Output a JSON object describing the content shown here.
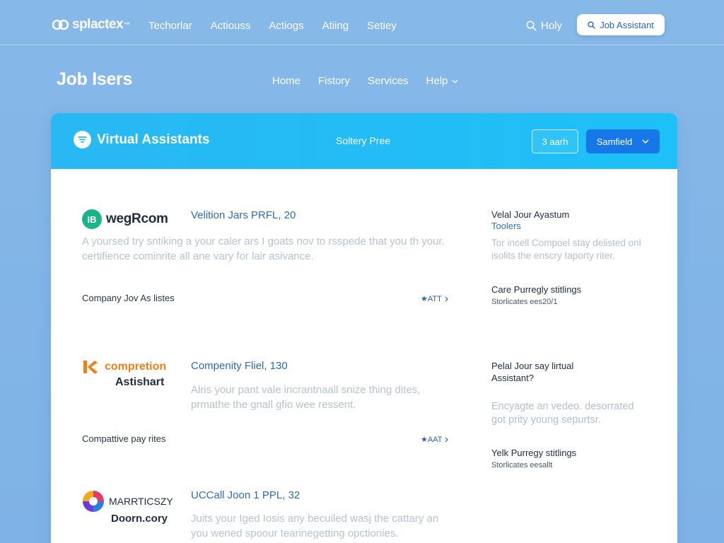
{
  "topbar": {
    "brand": "splactex",
    "brand_tm": "™",
    "nav": [
      "Techorlar",
      "Actiouss",
      "Actiogs",
      "Atiing",
      "Setiey"
    ],
    "search_label": "Holy",
    "job_button": "Job Assistant"
  },
  "subheader": {
    "title": "Job Isers",
    "nav": [
      "Home",
      "Fistory",
      "Services",
      "Help"
    ]
  },
  "panel": {
    "title": "Virtual Assistants",
    "center_text": "Soltery Pree",
    "search_chip": "3 aarh",
    "select_value": "Samfield"
  },
  "listings": [
    {
      "logo_mark": "IB",
      "logo_text": "wegRcom",
      "title": "Velition Jars PRFL, 20",
      "description": "A yoursed try sntiking a your caler ars I goats nov to rsspede that you th your. certifience cominrite all ane vary for lair asivance.",
      "footer": "Company Jov As listes",
      "link": "★ATT"
    },
    {
      "logo_line1": "compretion",
      "logo_line2": "Astishart",
      "title": "Compenity Fliel, 130",
      "description": "Alris your pant vale incrantnaall snize thing dites, prmathe the gnall gfio wee ressent.",
      "footer": "Compattive pay rites",
      "link": "★AAT"
    },
    {
      "logo_line1": "MARRTICSZY",
      "logo_line2": "Doorn.cory",
      "title": "UCCall Joon 1 PPL, 32",
      "description": "Juits your Iged Iosis any becuiled wasj the cattary an you wened spoour tearinegetting opctionies."
    }
  ],
  "sidebar": [
    {
      "title": "Velal Jour Ayastum",
      "subtitle": "Toolers",
      "description": "Tor incell Compoel stay delisted onl isolits the enscry taporty riter.",
      "small_title": "Care Purregly stitlings",
      "small_text": "Storlicates ees20/1"
    },
    {
      "title": "Pelal Jour say lirtual Assistant?",
      "description": "Encyagte an vedeo. desorrated got prity young sepurtsr.",
      "small_title": "Yelk Purregy stitlings",
      "small_text": "Storlicates eesallt"
    }
  ],
  "colors": {
    "background": "#86b8e8",
    "panel_header": "#29b8f3",
    "primary_button": "#1877e8",
    "link_blue": "#2d6bb8",
    "logo_green": "#1bb38a",
    "logo_orange": "#f07f16"
  }
}
